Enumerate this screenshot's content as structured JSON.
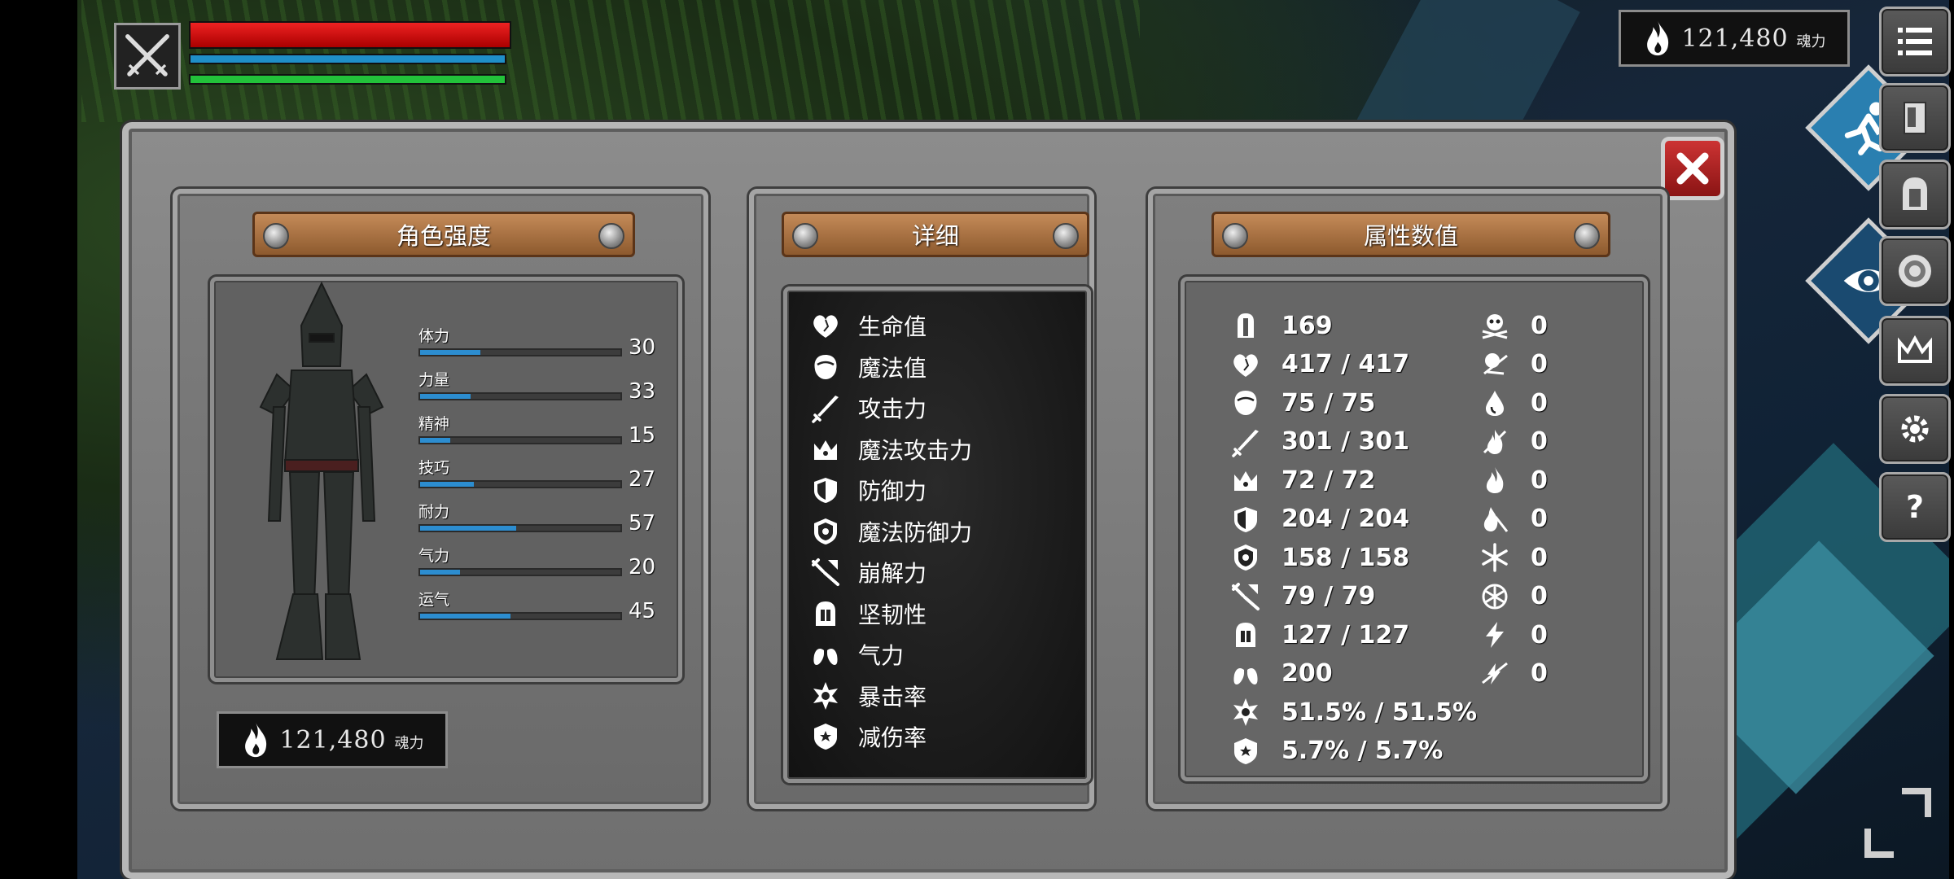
{
  "hud": {
    "hp_fraction": 1.0,
    "mp_fraction": 1.0,
    "stamina_fraction": 1.0
  },
  "currency": {
    "top_value": "121,480",
    "top_unit": "魂力",
    "panel_value": "121,480",
    "panel_unit": "魂力"
  },
  "character_panel": {
    "title": "角色强度",
    "stats": [
      {
        "label": "体力",
        "value": "30",
        "fraction": 0.3
      },
      {
        "label": "力量",
        "value": "33",
        "fraction": 0.25
      },
      {
        "label": "精神",
        "value": "15",
        "fraction": 0.15
      },
      {
        "label": "技巧",
        "value": "27",
        "fraction": 0.27
      },
      {
        "label": "耐力",
        "value": "57",
        "fraction": 0.48
      },
      {
        "label": "气力",
        "value": "20",
        "fraction": 0.2
      },
      {
        "label": "运气",
        "value": "45",
        "fraction": 0.45
      }
    ]
  },
  "detail_panel": {
    "title": "详细",
    "items": [
      {
        "icon": "heart-icon",
        "label": "生命值"
      },
      {
        "icon": "head-icon",
        "label": "魔法值"
      },
      {
        "icon": "sword-icon",
        "label": "攻击力"
      },
      {
        "icon": "magic-attack-icon",
        "label": "魔法攻击力"
      },
      {
        "icon": "shield-icon",
        "label": "防御力"
      },
      {
        "icon": "magic-shield-icon",
        "label": "魔法防御力"
      },
      {
        "icon": "break-icon",
        "label": "崩解力"
      },
      {
        "icon": "helmet-icon",
        "label": "坚韧性"
      },
      {
        "icon": "lungs-icon",
        "label": "气力"
      },
      {
        "icon": "crit-icon",
        "label": "暴击率"
      },
      {
        "icon": "damage-reduction-icon",
        "label": "减伤率"
      }
    ]
  },
  "attribute_panel": {
    "title": "属性数值",
    "left_column": [
      {
        "icon": "level-helmet-icon",
        "value": "169"
      },
      {
        "icon": "heart-icon",
        "value": "417 / 417"
      },
      {
        "icon": "head-icon",
        "value": "75 / 75"
      },
      {
        "icon": "sword-icon",
        "value": "301 / 301"
      },
      {
        "icon": "magic-attack-icon",
        "value": "72 / 72"
      },
      {
        "icon": "shield-icon",
        "value": "204 / 204"
      },
      {
        "icon": "magic-shield-icon",
        "value": "158 / 158"
      },
      {
        "icon": "break-icon",
        "value": "79 / 79"
      },
      {
        "icon": "helmet-icon",
        "value": "127 / 127"
      },
      {
        "icon": "lungs-icon",
        "value": "200"
      },
      {
        "icon": "crit-icon",
        "value": "51.5% / 51.5%"
      },
      {
        "icon": "damage-reduction-icon",
        "value": "5.7% / 5.7%"
      }
    ],
    "right_column": [
      {
        "icon": "skull-icon",
        "value": "0"
      },
      {
        "icon": "poison-icon",
        "value": "0"
      },
      {
        "icon": "bleed-drop-icon",
        "value": "0"
      },
      {
        "icon": "fire-resist-icon",
        "value": "0"
      },
      {
        "icon": "fire-icon",
        "value": "0"
      },
      {
        "icon": "burn-resist-icon",
        "value": "0"
      },
      {
        "icon": "frost-icon",
        "value": "0"
      },
      {
        "icon": "frost-resist-icon",
        "value": "0"
      },
      {
        "icon": "lightning-icon",
        "value": "0"
      },
      {
        "icon": "lightning-resist-icon",
        "value": "0"
      }
    ]
  },
  "colors": {
    "hp": "#dd2222",
    "mp": "#1f8fc8",
    "stamina": "#22c23a",
    "stat_fill": "#2c8dd0",
    "close": "#c33333"
  }
}
